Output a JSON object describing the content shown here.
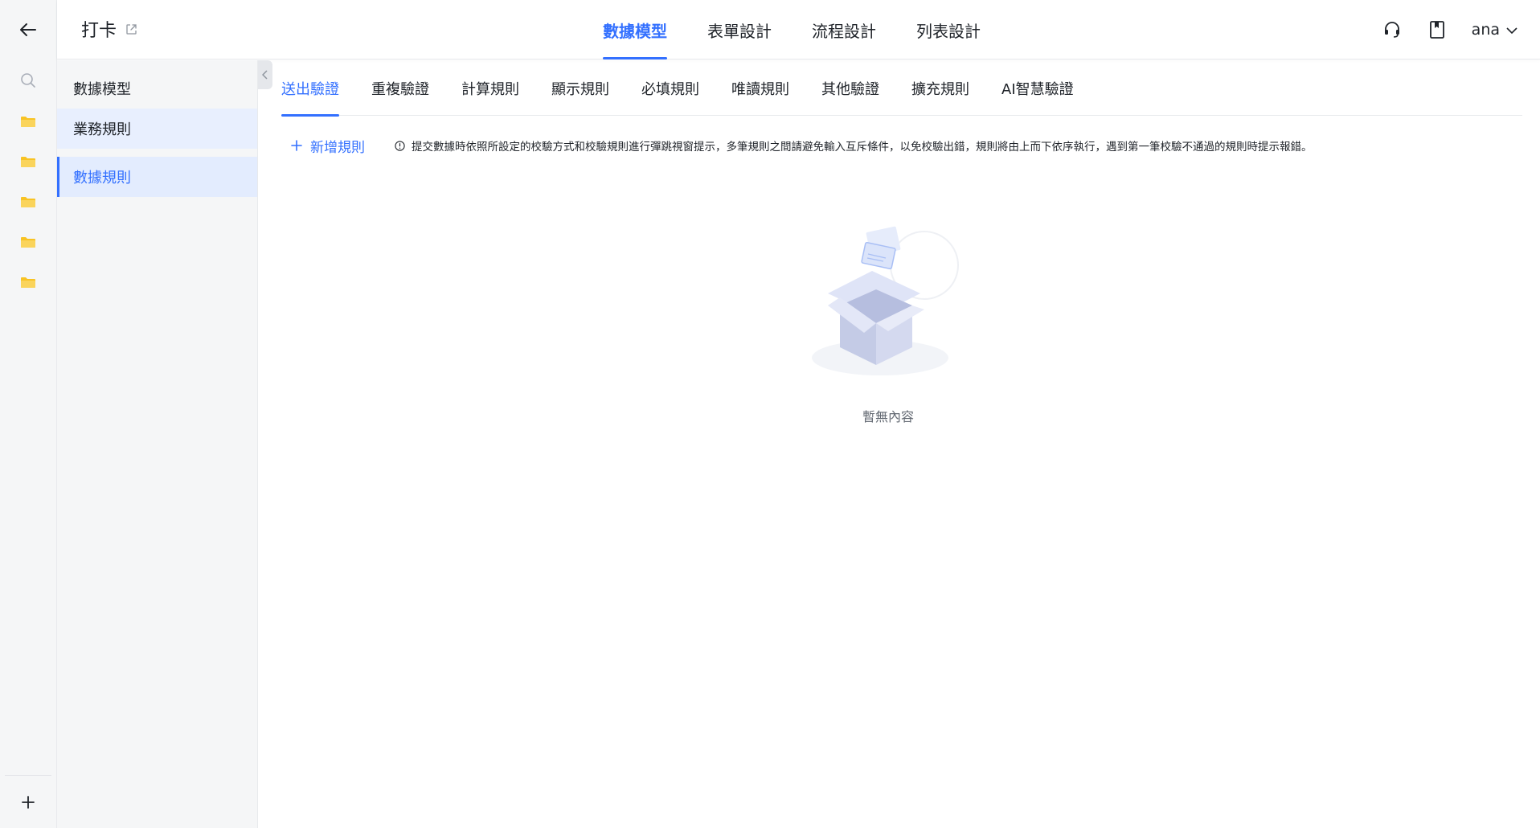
{
  "app": {
    "title": "打卡"
  },
  "top_nav": [
    {
      "label": "數據模型",
      "active": true
    },
    {
      "label": "表單設計",
      "active": false
    },
    {
      "label": "流程設計",
      "active": false
    },
    {
      "label": "列表設計",
      "active": false
    }
  ],
  "user": {
    "name": "ana"
  },
  "sidebar": {
    "items": [
      {
        "label": "數據模型"
      },
      {
        "label": "業務規則"
      },
      {
        "label": "數據規則"
      }
    ]
  },
  "sub_tabs": [
    {
      "label": "送出驗證"
    },
    {
      "label": "重複驗證"
    },
    {
      "label": "計算規則"
    },
    {
      "label": "顯示規則"
    },
    {
      "label": "必填規則"
    },
    {
      "label": "唯讀規則"
    },
    {
      "label": "其他驗證"
    },
    {
      "label": "擴充規則"
    },
    {
      "label": "AI智慧驗證"
    }
  ],
  "toolbar": {
    "add_label": "新增規則",
    "hint": "提交數據時依照所設定的校驗方式和校驗規則進行彈跳視窗提示，多筆規則之間請避免輸入互斥條件，以免校驗出錯，規則將由上而下依序執行，遇到第一筆校驗不通過的規則時提示報錯。"
  },
  "empty": {
    "text": "暫無內容"
  },
  "colors": {
    "accent": "#3370ff",
    "folder": "#f8c324"
  }
}
